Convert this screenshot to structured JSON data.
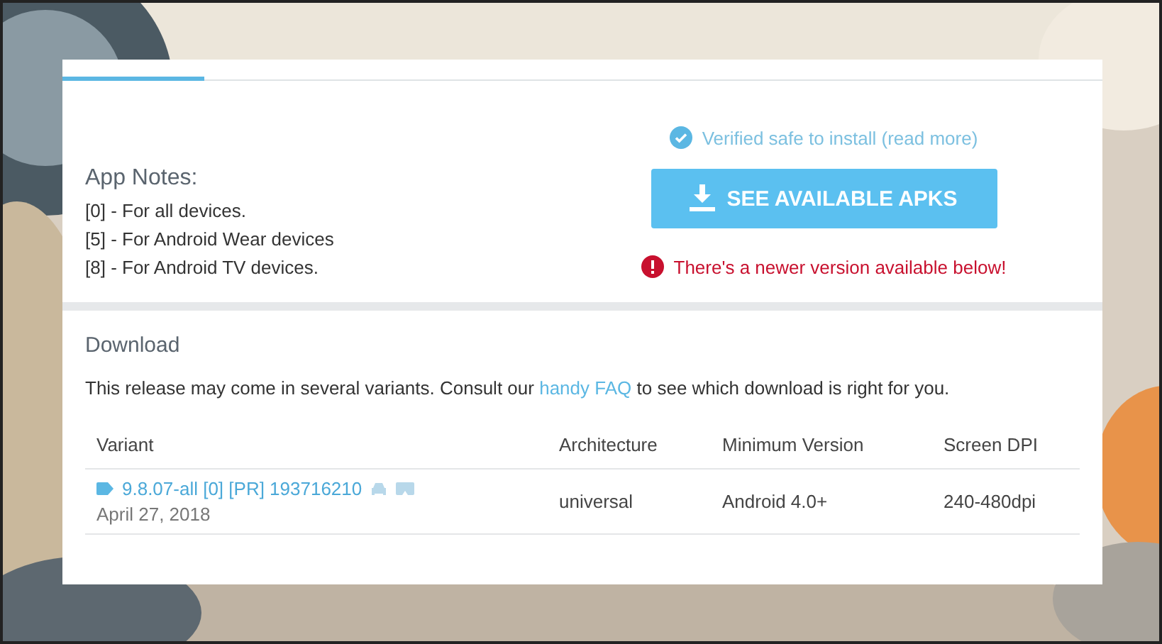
{
  "verified": {
    "text": "Verified safe to install (read more)"
  },
  "download_button": {
    "label": "SEE AVAILABLE APKS"
  },
  "warning": {
    "text": "There's a newer version available below!"
  },
  "app_notes": {
    "title": "App Notes:",
    "lines": [
      "[0] - For all devices.",
      "[5] - For Android Wear devices",
      "[8] - For Android TV devices."
    ]
  },
  "download": {
    "title": "Download",
    "intro_before": "This release may come in several variants. Consult our",
    "intro_link": "handy FAQ",
    "intro_after": "to see which download is right for you."
  },
  "table": {
    "columns": [
      "Variant",
      "Architecture",
      "Minimum Version",
      "Screen DPI"
    ],
    "rows": [
      {
        "variant": "9.8.07-all [0] [PR] 193716210",
        "date": "April 27, 2018",
        "architecture": "universal",
        "min_version": "Android 4.0+",
        "dpi": "240-480dpi"
      }
    ]
  }
}
